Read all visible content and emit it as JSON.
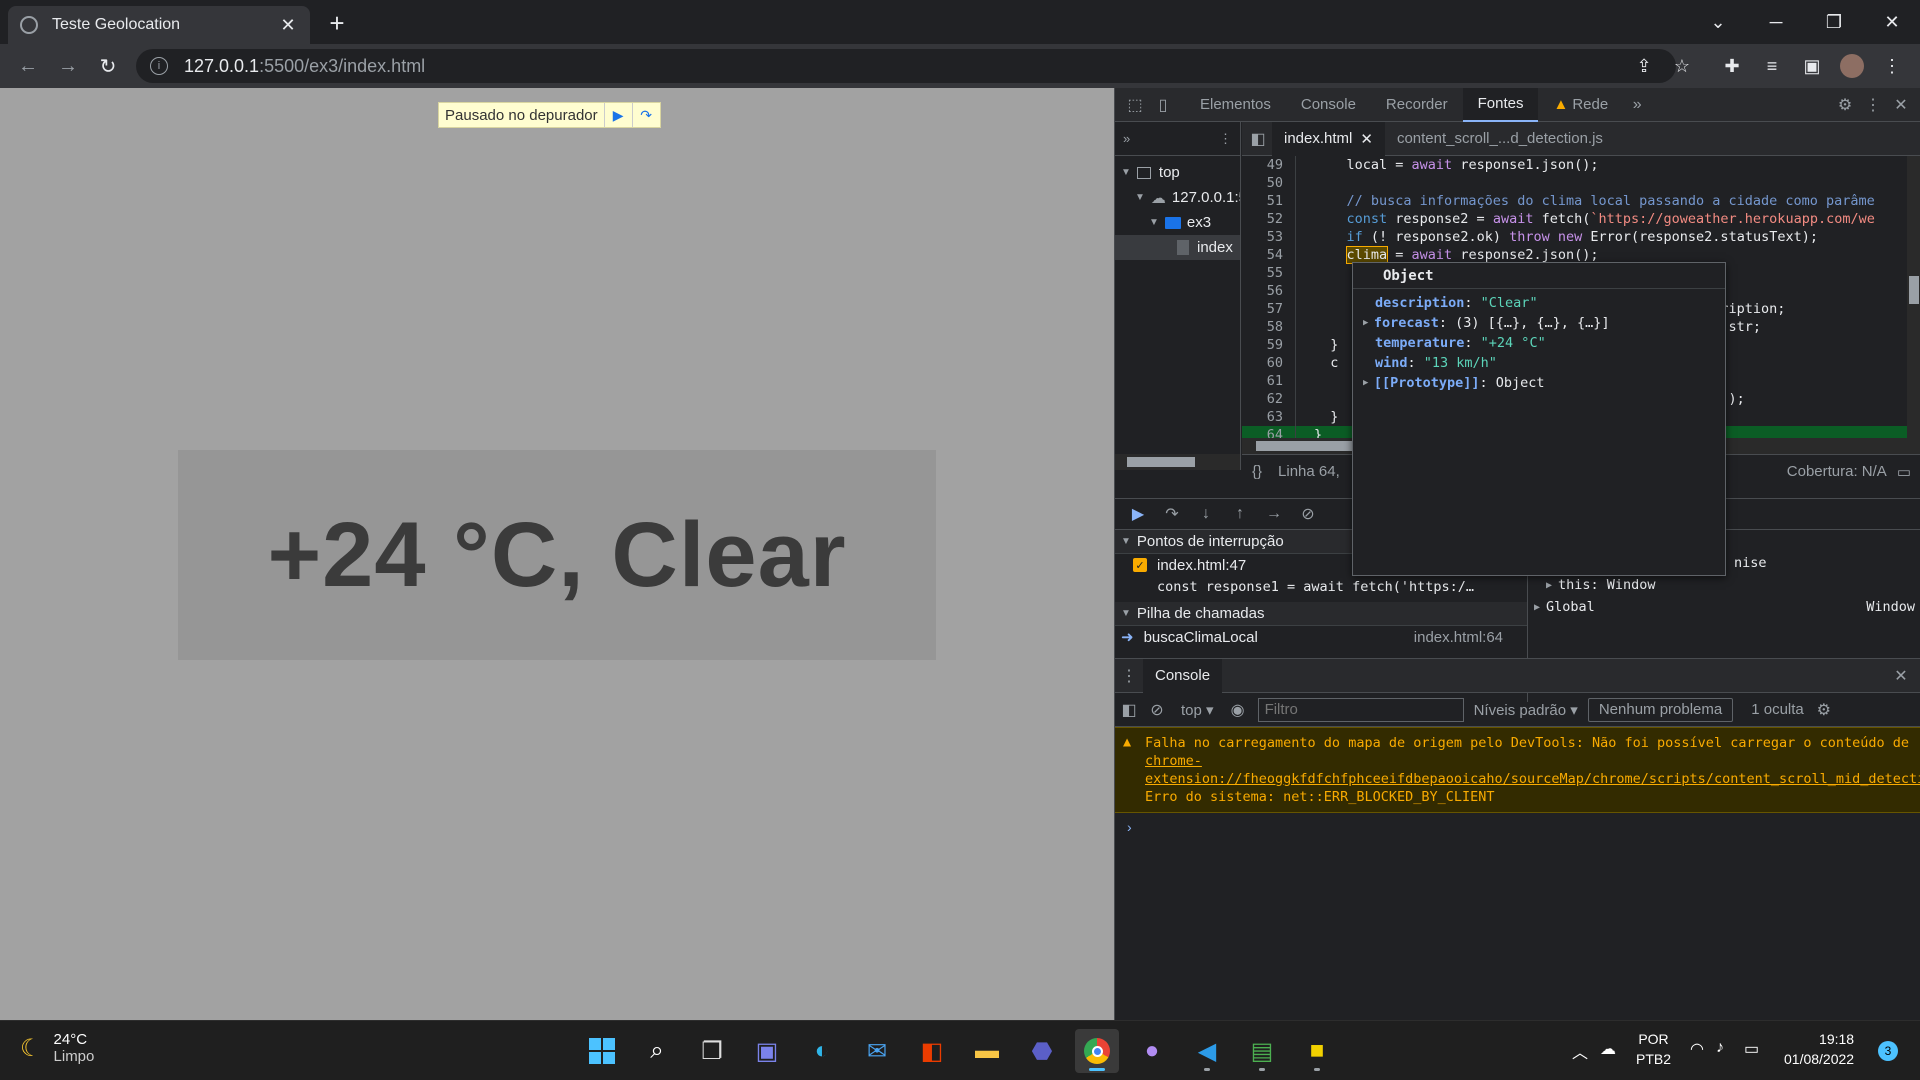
{
  "browser": {
    "tab_title": "Teste Geolocation",
    "url_host": "127.0.0.1",
    "url_path": ":5500/ex3/index.html"
  },
  "page": {
    "paused_label": "Pausado no depurador",
    "weather_text": "+24 °C, Clear"
  },
  "devtools": {
    "tabs": [
      "Elementos",
      "Console",
      "Recorder",
      "Fontes",
      "Rede"
    ],
    "active_tab": "Fontes",
    "nav_tree": {
      "top": "top",
      "host": "127.0.0.1:5",
      "folder": "ex3",
      "file": "index"
    },
    "editor_tabs": [
      "index.html",
      "content_scroll_...d_detection.js"
    ],
    "code_lines": [
      {
        "n": "49",
        "t": "    local = await response1.json();"
      },
      {
        "n": "50",
        "t": ""
      },
      {
        "n": "51",
        "t": "    // busca informações do clima local passando a cidade como parâme"
      },
      {
        "n": "52",
        "t": "    const response2 = await fetch(`https://goweather.herokuapp.com/we"
      },
      {
        "n": "53",
        "t": "    if (! response2.ok) throw new Error(response2.statusText);"
      },
      {
        "n": "54",
        "t": "    clima = await response2.json();"
      },
      {
        "n": "55",
        "t": ""
      },
      {
        "n": "56",
        "t": ""
      },
      {
        "n": "57",
        "t": "                                             .description;"
      },
      {
        "n": "58",
        "t": "                                             ext = str;"
      },
      {
        "n": "59",
        "t": "  }"
      },
      {
        "n": "60",
        "t": "  c"
      },
      {
        "n": "61",
        "t": ""
      },
      {
        "n": "62",
        "t": "                                             local');"
      },
      {
        "n": "63",
        "t": "  }"
      },
      {
        "n": "64",
        "t": "}"
      }
    ],
    "status_line": "Linha 64,",
    "coverage": "Cobertura: N/A",
    "breakpoints_header": "Pontos de interrupção",
    "breakpoint_file": "index.html:47",
    "breakpoint_code": "const response1 = await fetch('https:/…",
    "callstack_header": "Pilha de chamadas",
    "callstack_fn": "buscaClimaLocal",
    "callstack_loc": "index.html:64",
    "scope_promise": "nise",
    "scope_this": "this: Window",
    "scope_global": "Global",
    "scope_global_val": "Window"
  },
  "popover": {
    "title": "Object",
    "rows": [
      {
        "k": "description",
        "v": "\"Clear\"",
        "exp": false
      },
      {
        "k": "forecast",
        "v": "(3) [{…}, {…}, {…}]",
        "exp": true
      },
      {
        "k": "temperature",
        "v": "\"+24 °C\"",
        "exp": false
      },
      {
        "k": "wind",
        "v": "\"13 km/h\"",
        "exp": false
      },
      {
        "k": "[[Prototype]]",
        "v": "Object",
        "exp": true
      }
    ]
  },
  "console": {
    "tab": "Console",
    "context": "top",
    "filter_placeholder": "Filtro",
    "levels": "Níveis padrão",
    "issues": "Nenhum problema",
    "hidden": "1 oculta",
    "warning_pre": "Falha no carregamento do mapa de origem pelo DevTools: Não foi possível carregar o conteúdo de ",
    "warning_link": "chrome-extension://fheoggkfdfchfphceeifdbepaooicaho/sourceMap/chrome/scripts/content_scroll_mid_detection.map",
    "warning_post": ": Erro do sistema: net::ERR_BLOCKED_BY_CLIENT"
  },
  "taskbar": {
    "temp": "24°C",
    "condition": "Limpo",
    "lang1": "POR",
    "lang2": "PTB2",
    "time": "19:18",
    "date": "01/08/2022",
    "notifications": "3"
  },
  "colors": {
    "page_bg": "#a2a2a2",
    "weather_box": "#969696",
    "accent": "#8ab4f8",
    "warning": "#f9ab00"
  }
}
